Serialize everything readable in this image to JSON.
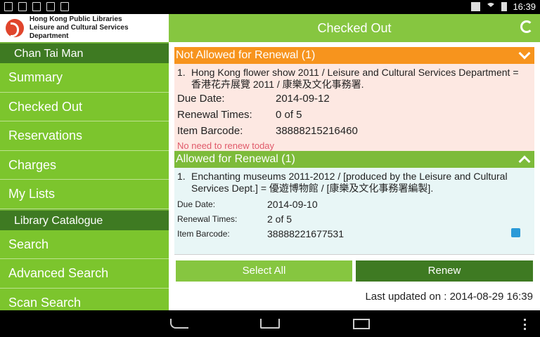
{
  "status_bar": {
    "time": "16:39"
  },
  "sidebar": {
    "logo": {
      "line1": "Hong Kong Public Libraries",
      "line2": "Leisure and Cultural Services Department"
    },
    "user_name": "Chan Tai Man",
    "account_items": [
      "Summary",
      "Checked Out",
      "Reservations",
      "Charges",
      "My Lists"
    ],
    "catalogue_header": "Library Catalogue",
    "catalogue_items": [
      "Search",
      "Advanced Search",
      "Scan Search"
    ]
  },
  "header": {
    "title": "Checked Out"
  },
  "not_allowed": {
    "header": "Not Allowed for Renewal (1)",
    "items": [
      {
        "number": "1.",
        "title": "Hong Kong flower show 2011 / Leisure and Cultural Services Department = 香港花卉展覽 2011 / 康樂及文化事務署.",
        "due_date_label": "Due Date:",
        "due_date": "2014-09-12",
        "renewal_label": "Renewal Times:",
        "renewal_times": "0 of 5",
        "barcode_label": "Item Barcode:",
        "barcode": "38888215216460",
        "note": "No need to renew today"
      }
    ]
  },
  "allowed": {
    "header": "Allowed for Renewal (1)",
    "items": [
      {
        "number": "1.",
        "title": "Enchanting museums 2011-2012 / [produced by the Leisure and Cultural Services Dept.] = 優遊博物館 / [康樂及文化事務署編製].",
        "due_date_label": "Due Date:",
        "due_date": "2014-09-10",
        "renewal_label": "Renewal Times:",
        "renewal_times": "2 of 5",
        "barcode_label": "Item Barcode:",
        "barcode": "38888221677531",
        "selected": true
      }
    ]
  },
  "actions": {
    "select_all": "Select All",
    "renew": "Renew"
  },
  "last_updated": "Last updated on : 2014-08-29 16:39",
  "colors": {
    "primary_green": "#7cc52d",
    "dark_green": "#3e7a22",
    "orange": "#f7941d",
    "accent_blue": "#2a9ad8"
  }
}
